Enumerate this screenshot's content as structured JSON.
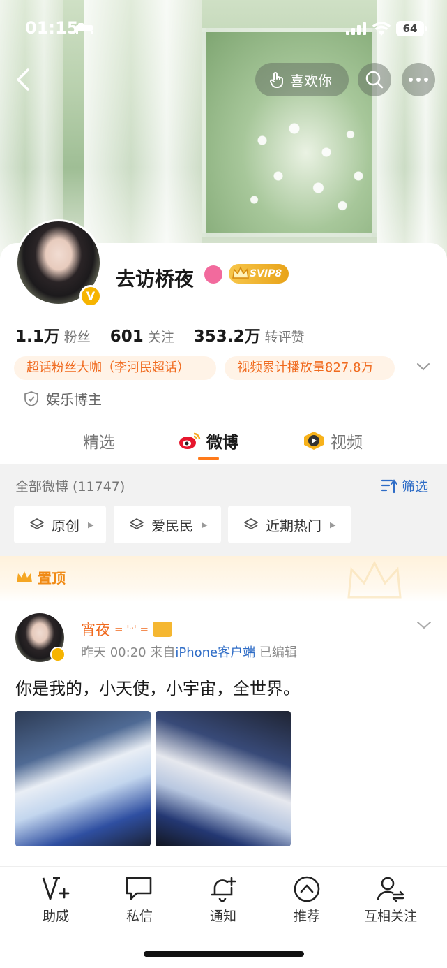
{
  "status_bar": {
    "time": "01:15",
    "battery": "64"
  },
  "header": {
    "like_label": "喜欢你"
  },
  "profile": {
    "username": "去访桥夜",
    "vip_badge": "SVIP8",
    "stats": [
      {
        "value": "1.1万",
        "label": "粉丝"
      },
      {
        "value": "601",
        "label": "关注"
      },
      {
        "value": "353.2万",
        "label": "转评赞"
      }
    ],
    "tags": [
      "超话粉丝大咖（李河民超话）",
      "视频累计播放量827.8万"
    ],
    "role": "娱乐博主"
  },
  "tabs": [
    "精选",
    "微博",
    "视频"
  ],
  "filters": {
    "all_label": "全部微博 (11747)",
    "filter_label": "筛选",
    "chips": [
      "原创",
      "爱民民",
      "近期热门"
    ]
  },
  "pinned": {
    "label": "置顶"
  },
  "post": {
    "author": "宵夜",
    "author_emote": "= 'ᵕ' =",
    "time": "昨天 00:20",
    "source_prefix": "来自",
    "source": "iPhone客户端",
    "edited": "已编辑",
    "text": "你是我的，小天使，小宇宙，全世界。"
  },
  "bottom_nav": [
    "助威",
    "私信",
    "通知",
    "推荐",
    "互相关注"
  ],
  "colors": {
    "accent": "#ff7a1a",
    "link": "#2e6cc6",
    "tag_text": "#f06a1e",
    "vip_gold": "#f6b400"
  }
}
